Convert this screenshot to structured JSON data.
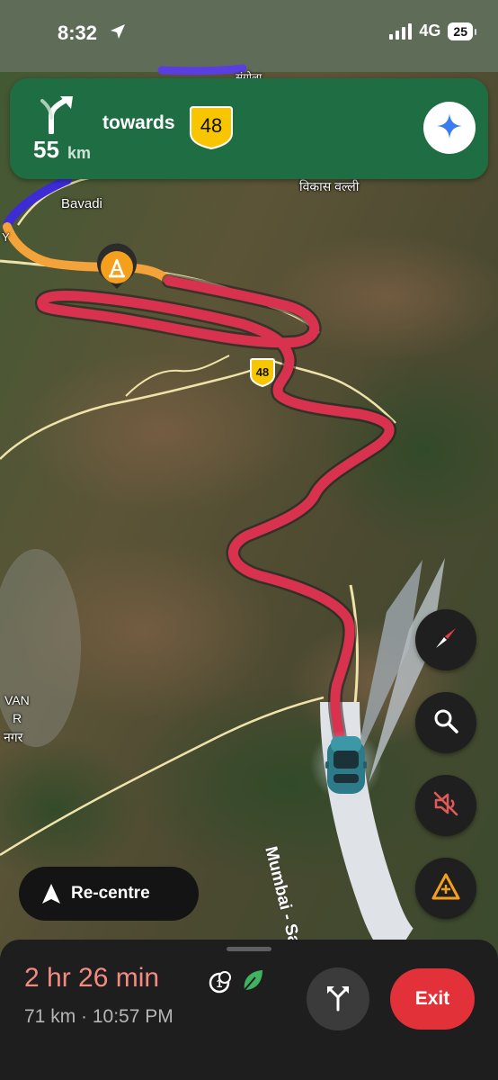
{
  "status_bar": {
    "time": "8:32",
    "network": "4G",
    "battery": "25"
  },
  "navigation": {
    "distance_value": "55",
    "distance_unit": "km",
    "towards_label": "towards",
    "route_shield": "48",
    "maneuver_icon": "turn-slight-right-icon",
    "assistant_icon": "sparkle-icon"
  },
  "map": {
    "labels": {
      "bavadi": "Bavadi",
      "sangola": "संगोला",
      "vikas_valli": "विकास वल्ली",
      "road_edge": "Y",
      "van": "VAN",
      "r": "R",
      "nagar": "नगर",
      "highway": "Mumbai - Satara Hwy"
    },
    "road_shield": "48",
    "incident_icon": "construction-icon",
    "colors": {
      "route_traffic": "#d8324f",
      "route_start": "#3d2bd6",
      "route_orange": "#f4a33a",
      "banner_green": "#1f6e43"
    }
  },
  "controls": {
    "compass_icon": "compass-icon",
    "search_icon": "search-icon",
    "mute_icon": "sound-off-icon",
    "report_icon": "report-incident-icon",
    "recentre_label": "Re-centre",
    "recentre_icon": "navigation-arrow-icon"
  },
  "trip": {
    "duration": "2 hr 26 min",
    "distance": "71 km",
    "separator": " · ",
    "arrival": "10:57 PM",
    "alt_routes_icon": "alternate-routes-icon",
    "exit_label": "Exit"
  }
}
